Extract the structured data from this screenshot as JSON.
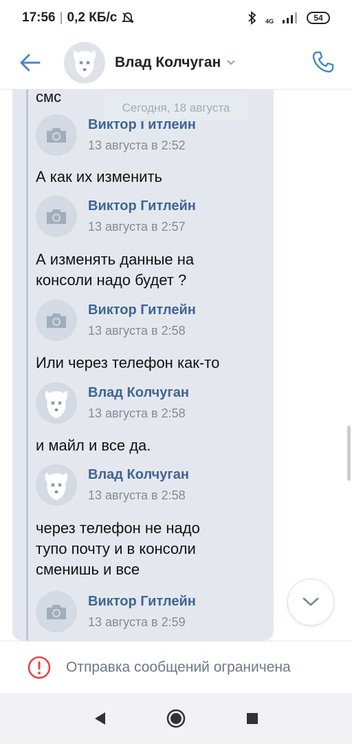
{
  "status_bar": {
    "time": "17:56",
    "speed": "0,2 КБ/с",
    "network": "4G",
    "battery": "54"
  },
  "header": {
    "title": "Влад Колчуган"
  },
  "date_pill": "Сегодня, 18 августа",
  "messages": [
    {
      "text": "смс"
    },
    {
      "name": "Виктор Гитлейн",
      "time": "13 августа в 2:52",
      "avatar": "camera-icon",
      "text": "А как их изменить"
    },
    {
      "name": "Виктор Гитлейн",
      "time": "13 августа в 2:57",
      "avatar": "camera-icon",
      "text": "А изменять данные на консоли надо будет ?"
    },
    {
      "name": "Виктор Гитлейн",
      "time": "13 августа в 2:58",
      "avatar": "camera-icon",
      "text": "Или через телефон как-то"
    },
    {
      "name": "Влад Колчуган",
      "time": "13 августа в 2:58",
      "avatar": "dog-avatar",
      "text": "и майл и все да."
    },
    {
      "name": "Влад Колчуган",
      "time": "13 августа в 2:58",
      "avatar": "dog-avatar",
      "text": "через телефон не надо тупо почту и в консоли сменишь и все"
    },
    {
      "name": "Виктор Гитлейн",
      "time": "13 августа в 2:59",
      "avatar": "camera-icon"
    }
  ],
  "restricted": {
    "text": "Отправка сообщений ограничена"
  },
  "colors": {
    "accent": "#4a86c8",
    "link_name": "#3f6593",
    "bubble": "#e4e8ee",
    "warning": "#e64646"
  }
}
